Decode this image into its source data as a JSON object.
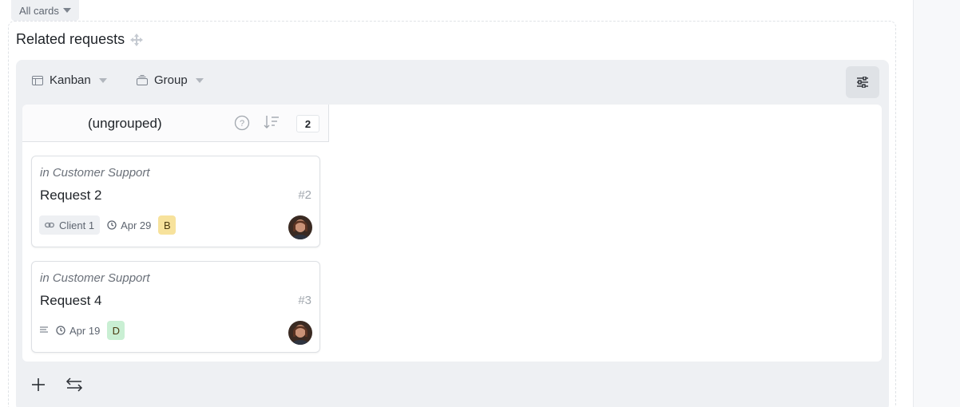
{
  "filter": {
    "label": "All cards"
  },
  "section": {
    "title": "Related requests"
  },
  "toolbar": {
    "view_label": "Kanban",
    "group_label": "Group"
  },
  "column": {
    "title": "(ungrouped)",
    "count": "2"
  },
  "cards": [
    {
      "context": "in Customer Support",
      "title": "Request 2",
      "number": "#2",
      "link_label": "Client 1",
      "date": "Apr 29",
      "letter": "B",
      "letter_color": "#f7e29c"
    },
    {
      "context": "in Customer Support",
      "title": "Request 4",
      "number": "#3",
      "date": "Apr 19",
      "letter": "D",
      "letter_color": "#c9efd3"
    }
  ]
}
